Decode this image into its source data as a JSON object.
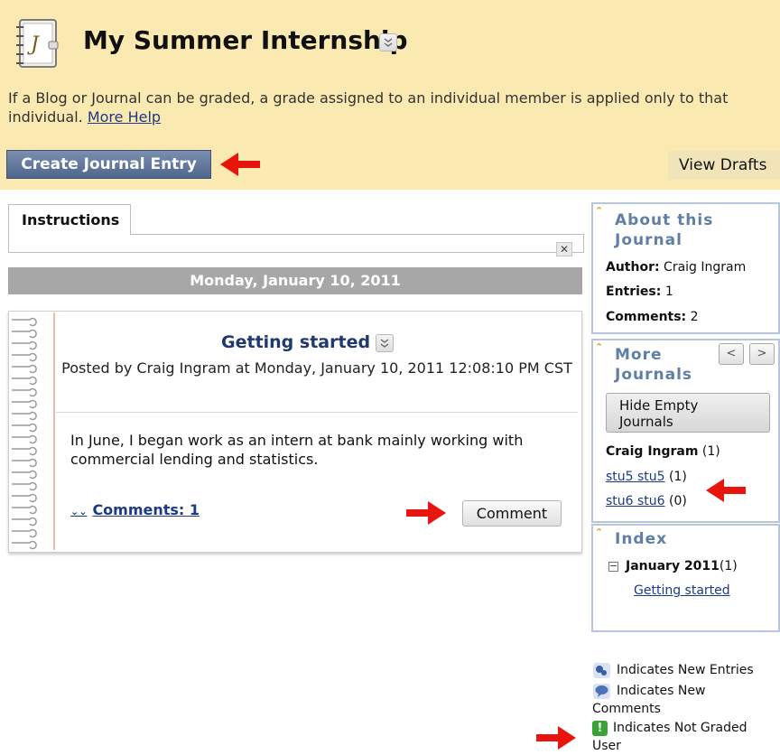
{
  "header": {
    "title": "My Summer Internship",
    "help_text": "If a Blog or Journal can be graded, a grade assigned to an individual member is applied only to that individual.",
    "help_link": "More Help",
    "create_button": "Create Journal Entry",
    "view_drafts": "View Drafts"
  },
  "instructions": {
    "tab_label": "Instructions",
    "close_glyph": "✕"
  },
  "date_bar": "Monday, January 10, 2011",
  "entry": {
    "title": "Getting started",
    "meta": "Posted by Craig Ingram at Monday, January 10, 2011 12:08:10 PM CST",
    "body": "In June, I began work as an intern at bank mainly working with commercial lending and statistics.",
    "comments_link": "Comments: 1",
    "comment_button": "Comment"
  },
  "sidebar": {
    "about": {
      "title_line1": "About this",
      "title_line2": "Journal",
      "author_label": "Author:",
      "author_value": "Craig Ingram",
      "entries_label": "Entries:",
      "entries_value": "1",
      "comments_label": "Comments:",
      "comments_value": "2"
    },
    "more": {
      "title_line1": "More",
      "title_line2": "Journals",
      "prev_glyph": "<",
      "next_glyph": ">",
      "hide_button_line1": "Hide Empty",
      "hide_button_line2": "Journals",
      "journals": [
        {
          "name": "Craig Ingram",
          "count": "(1)"
        },
        {
          "name": "stu5 stu5",
          "count": "(1)"
        },
        {
          "name": "stu6 stu6",
          "count": "(0)"
        }
      ]
    },
    "index": {
      "title": "Index",
      "toggle_glyph": "−",
      "month": "January 2011",
      "month_count": "(1)",
      "entry_link": "Getting started"
    }
  },
  "legend": {
    "new_entries": "Indicates New Entries",
    "new_comments_line1": "Indicates New",
    "new_comments_line2": "Comments",
    "not_graded_line1": "Indicates Not Graded",
    "not_graded_line2": "User",
    "not_graded_glyph": "!"
  },
  "colors": {
    "header_bg": "#fbe9b2",
    "primary_button": "#5b6f95",
    "annotation_arrow": "#e8150f",
    "link": "#1c3a86",
    "sidebar_title": "#5f7fa6"
  }
}
